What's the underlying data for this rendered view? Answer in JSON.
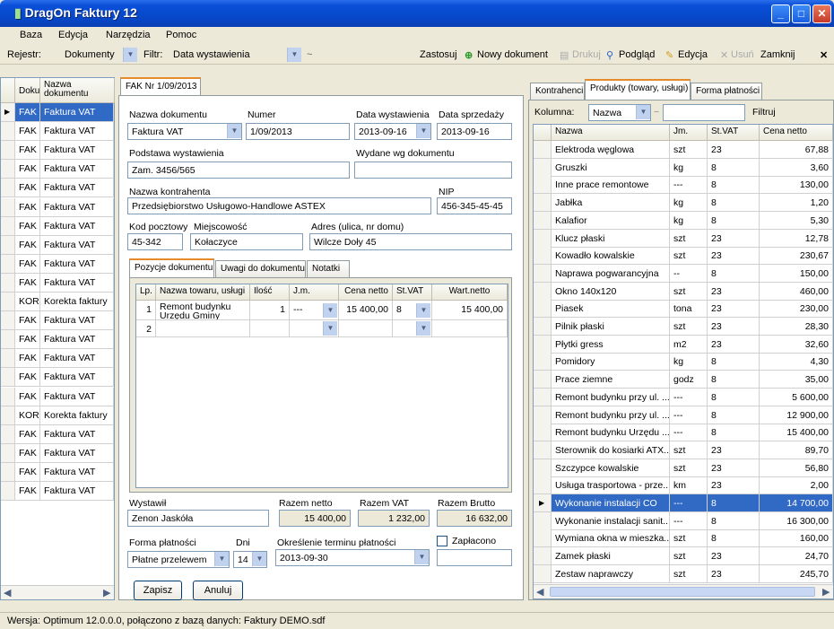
{
  "window": {
    "title": "DragOn Faktury 12"
  },
  "menu": [
    "Baza",
    "Edycja",
    "Narzędzia",
    "Pomoc"
  ],
  "toolbar": {
    "registry_label": "Rejestr:",
    "registry_value": "Dokumenty",
    "filter_label": "Filtr:",
    "filter_value": "Data wystawienia",
    "tilde": "~",
    "apply": "Zastosuj",
    "new_doc": "Nowy dokument",
    "print": "Drukuj",
    "preview": "Podgląd",
    "edit": "Edycja",
    "delete": "Usuń",
    "close": "Zamknij"
  },
  "doclist": {
    "col_type": "Dokum",
    "col_name": "Nazwa dokumentu",
    "rows": [
      [
        "FAK",
        "Faktura VAT"
      ],
      [
        "FAK",
        "Faktura VAT"
      ],
      [
        "FAK",
        "Faktura VAT"
      ],
      [
        "FAK",
        "Faktura VAT"
      ],
      [
        "FAK",
        "Faktura VAT"
      ],
      [
        "FAK",
        "Faktura VAT"
      ],
      [
        "FAK",
        "Faktura VAT"
      ],
      [
        "FAK",
        "Faktura VAT"
      ],
      [
        "FAK",
        "Faktura VAT"
      ],
      [
        "FAK",
        "Faktura VAT"
      ],
      [
        "KOR",
        "Korekta faktury"
      ],
      [
        "FAK",
        "Faktura VAT"
      ],
      [
        "FAK",
        "Faktura VAT"
      ],
      [
        "FAK",
        "Faktura VAT"
      ],
      [
        "FAK",
        "Faktura VAT"
      ],
      [
        "FAK",
        "Faktura VAT"
      ],
      [
        "KOR",
        "Korekta faktury"
      ],
      [
        "FAK",
        "Faktura VAT"
      ],
      [
        "FAK",
        "Faktura VAT"
      ],
      [
        "FAK",
        "Faktura VAT"
      ],
      [
        "FAK",
        "Faktura VAT"
      ]
    ]
  },
  "doc": {
    "tab": "FAK Nr 1/09/2013",
    "l_name": "Nazwa dokumentu",
    "v_name": "Faktura VAT",
    "l_number": "Numer",
    "v_number": "1/09/2013",
    "l_issue": "Data wystawienia",
    "v_issue": "2013-09-16",
    "l_sale": "Data sprzedaży",
    "v_sale": "2013-09-16",
    "l_basis": "Podstawa wystawienia",
    "v_basis": "Zam. 3456/565",
    "l_issued_by_doc": "Wydane wg dokumentu",
    "v_issued_by_doc": "",
    "l_contractor": "Nazwa kontrahenta",
    "v_contractor": "Przedsiębiorstwo Usługowo-Handlowe ASTEX",
    "l_nip": "NIP",
    "v_nip": "456-345-45-45",
    "l_zip": "Kod pocztowy",
    "v_zip": "45-342",
    "l_city": "Miejscowość",
    "v_city": "Kołaczyce",
    "l_address": "Adres (ulica, nr domu)",
    "v_address": "Wilcze Doły 45",
    "subtabs": [
      "Pozycje dokumentu",
      "Uwagi do dokumentu",
      "Notatki"
    ],
    "items_cols": [
      "Lp.",
      "Nazwa towaru, usługi",
      "Ilość",
      "J.m.",
      "Cena netto",
      "St.VAT",
      "Wart.netto"
    ],
    "items": [
      {
        "lp": "1",
        "name": "Remont budynku Urzędu Gminy",
        "qty": "1",
        "unit": "---",
        "price": "15 400,00",
        "vat": "8",
        "value": "15 400,00"
      },
      {
        "lp": "2",
        "name": "",
        "qty": "",
        "unit": "",
        "price": "",
        "vat": "",
        "value": ""
      }
    ],
    "l_issuer": "Wystawił",
    "v_issuer": "Zenon Jaskóła",
    "l_net": "Razem netto",
    "v_net": "15 400,00",
    "l_vat": "Razem VAT",
    "v_vat": "1 232,00",
    "l_gross": "Razem Brutto",
    "v_gross": "16 632,00",
    "l_payment": "Forma płatności",
    "v_payment": "Płatne przelewem",
    "l_days": "Dni",
    "v_days": "14",
    "l_term": "Określenie terminu płatności",
    "v_term": "2013-09-30",
    "l_paid": "Zapłacono",
    "v_paid": "",
    "save": "Zapisz",
    "cancel": "Anuluj"
  },
  "right": {
    "tabs": [
      "Kontrahenci",
      "Produkty (towary, usługi)",
      "Forma płatności"
    ],
    "col_label": "Kolumna:",
    "col_value": "Nazwa",
    "tilde": "~",
    "filter": "Filtruj",
    "cols": [
      "Nazwa",
      "Jm.",
      "St.VAT",
      "Cena netto"
    ],
    "rows": [
      [
        "Elektroda węglowa",
        "szt",
        "23",
        "67,88"
      ],
      [
        "Gruszki",
        "kg",
        "8",
        "3,60"
      ],
      [
        "Inne prace remontowe",
        "---",
        "8",
        "130,00"
      ],
      [
        "Jabłka",
        "kg",
        "8",
        "1,20"
      ],
      [
        "Kalafior",
        "kg",
        "8",
        "5,30"
      ],
      [
        "Klucz płaski",
        "szt",
        "23",
        "12,78"
      ],
      [
        "Kowadło kowalskie",
        "szt",
        "23",
        "230,67"
      ],
      [
        "Naprawa pogwarancyjna",
        "--",
        "8",
        "150,00"
      ],
      [
        "Okno 140x120",
        "szt",
        "23",
        "460,00"
      ],
      [
        "Piasek",
        "tona",
        "23",
        "230,00"
      ],
      [
        "Pilnik płaski",
        "szt",
        "23",
        "28,30"
      ],
      [
        "Płytki gress",
        "m2",
        "23",
        "32,60"
      ],
      [
        "Pomidory",
        "kg",
        "8",
        "4,30"
      ],
      [
        "Prace ziemne",
        "godz",
        "8",
        "35,00"
      ],
      [
        "Remont budynku przy ul. ...",
        "---",
        "8",
        "5 600,00"
      ],
      [
        "Remont budynku przy ul. ...",
        "---",
        "8",
        "12 900,00"
      ],
      [
        "Remont budynku Urzędu ...",
        "---",
        "8",
        "15 400,00"
      ],
      [
        "Sterownik do kosiarki ATX...",
        "szt",
        "23",
        "89,70"
      ],
      [
        "Szczypce kowalskie",
        "szt",
        "23",
        "56,80"
      ],
      [
        "Usługa trasportowa - prze...",
        "km",
        "23",
        "2,00"
      ],
      [
        "Wykonanie instalacji CO",
        "---",
        "8",
        "14 700,00"
      ],
      [
        "Wykonanie instalacji sanit...",
        "---",
        "8",
        "16 300,00"
      ],
      [
        "Wymiana okna w mieszka...",
        "szt",
        "8",
        "160,00"
      ],
      [
        "Zamek płaski",
        "szt",
        "23",
        "24,70"
      ],
      [
        "Zestaw naprawczy",
        "szt",
        "23",
        "245,70"
      ]
    ],
    "selected_row": 20
  },
  "status": "Wersja: Optimum 12.0.0.0, połączono z bazą danych: Faktury DEMO.sdf"
}
